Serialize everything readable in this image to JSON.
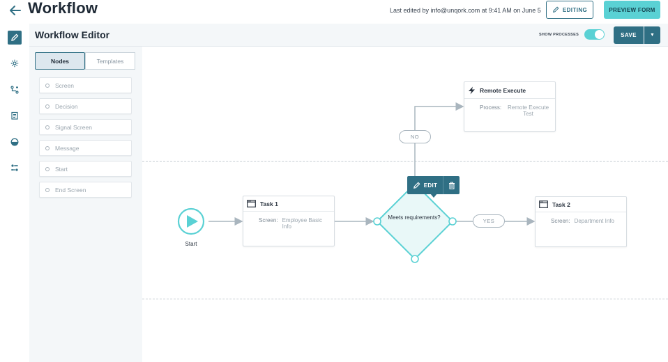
{
  "header": {
    "app_title": "Workflow",
    "last_edited": "Last edited by info@unqork.com at 9:41 AM on June 5",
    "editing_label": "EDITING",
    "preview_label": "PREVIEW FORM"
  },
  "rail": {
    "items": [
      {
        "icon": "pencil-icon",
        "active": true
      },
      {
        "icon": "gear-icon",
        "active": false
      },
      {
        "icon": "flow-icon",
        "active": false
      },
      {
        "icon": "clipboard-icon",
        "active": false
      },
      {
        "icon": "palette-icon",
        "active": false
      },
      {
        "icon": "sliders-icon",
        "active": false
      }
    ]
  },
  "editor": {
    "title": "Workflow Editor",
    "show_processes_label": "SHOW PROCESSES",
    "show_processes_on": true,
    "save_label": "SAVE",
    "save_dropdown_glyph": "▼"
  },
  "panel": {
    "tabs": [
      {
        "label": "Nodes",
        "active": true
      },
      {
        "label": "Templates",
        "active": false
      }
    ],
    "nodes": [
      "Screen",
      "Decision",
      "Signal Screen",
      "Message",
      "Start",
      "End Screen"
    ]
  },
  "canvas": {
    "start": {
      "label": "Start"
    },
    "task1": {
      "title": "Task 1",
      "key": "Screen:",
      "value": "Employee Basic Info"
    },
    "decision": {
      "label": "Meets requirements?"
    },
    "edit_toolbar": {
      "edit_label": "EDIT"
    },
    "yes_label": "YES",
    "no_label": "NO",
    "task2": {
      "title": "Task 2",
      "key": "Screen:",
      "value": "Department Info"
    },
    "remote": {
      "title": "Remote Execute",
      "key": "Process:",
      "value": "Remote Execute Test"
    }
  },
  "colors": {
    "primary": "#2f6f84",
    "accent": "#5ad1d4",
    "panel_bg": "#f4f7f9",
    "connector": "#a9b5be"
  }
}
